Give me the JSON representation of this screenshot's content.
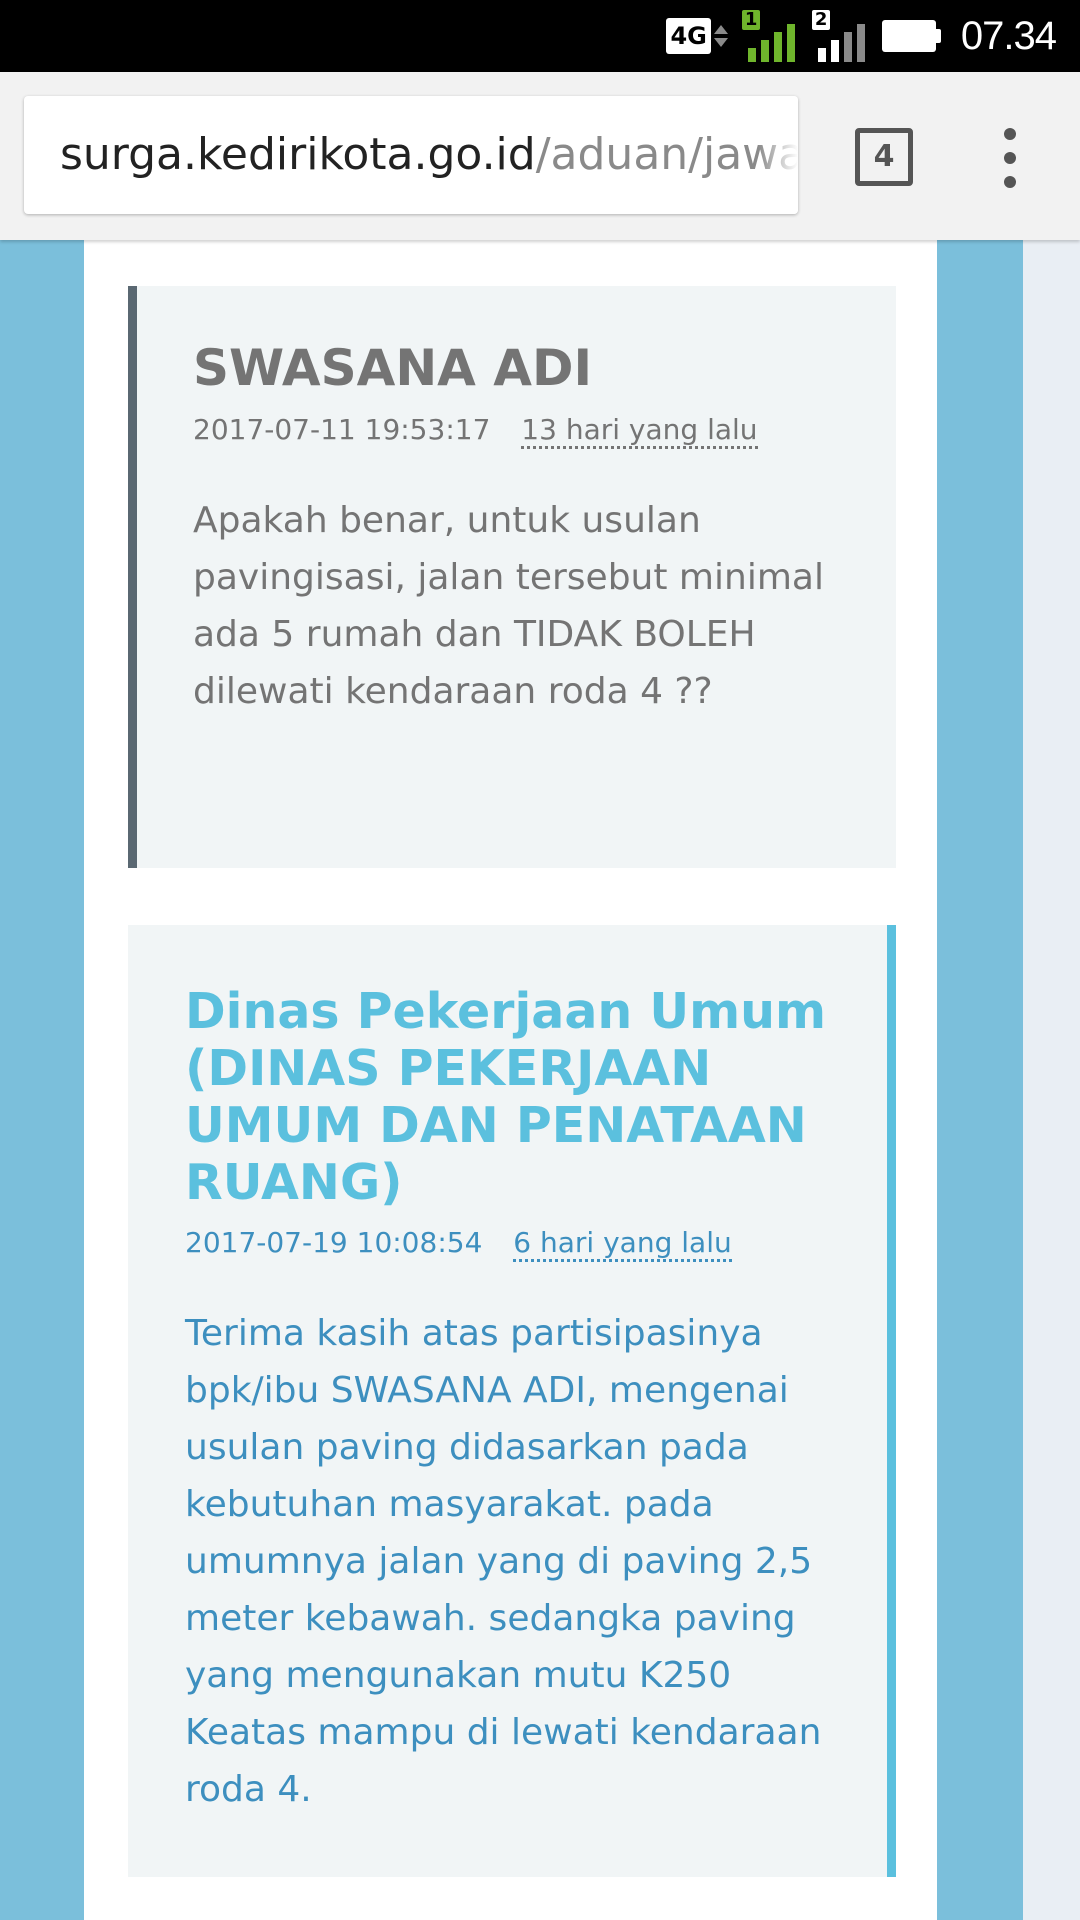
{
  "status_bar": {
    "network": "4G",
    "sim1_label": "1",
    "sim2_label": "2",
    "time": "07.34",
    "colors": {
      "sim1_signal": "#6fb52c",
      "sim2_signal": "#ffffff"
    }
  },
  "browser": {
    "url_host": "surga.kedirikota.go.id",
    "url_path": "/aduan/jawa",
    "tab_count": "4",
    "menu_icon": "three-dots-vertical-icon"
  },
  "thread": {
    "question": {
      "author": "SWASANA ADI",
      "datetime": "2017-07-11 19:53:17",
      "relative_time": "13 hari yang lalu",
      "body": "Apakah benar, untuk usulan pavingisasi, jalan tersebut minimal ada 5 rumah dan TIDAK BOLEH dilewati kendaraan roda 4 ??"
    },
    "answer": {
      "author": "Dinas Pekerjaan Umum (DINAS PEKERJAAN UMUM DAN PENATAAN RUANG)",
      "datetime": "2017-07-19 10:08:54",
      "relative_time": "6 hari yang lalu",
      "body": "Terima kasih atas partisipasinya bpk/ibu SWASANA ADI, mengenai usulan paving didasarkan pada kebutuhan masyarakat. pada umumnya jalan yang di paving 2,5 meter kebawah. sedangka paving yang mengunakan mutu K250 Keatas mampu di lewati kendaraan roda 4."
    }
  },
  "colors": {
    "page_background": "#7bbfdb",
    "question_accent": "#5a6872",
    "answer_accent": "#5bc0de",
    "answer_text": "#3d8fbf"
  }
}
